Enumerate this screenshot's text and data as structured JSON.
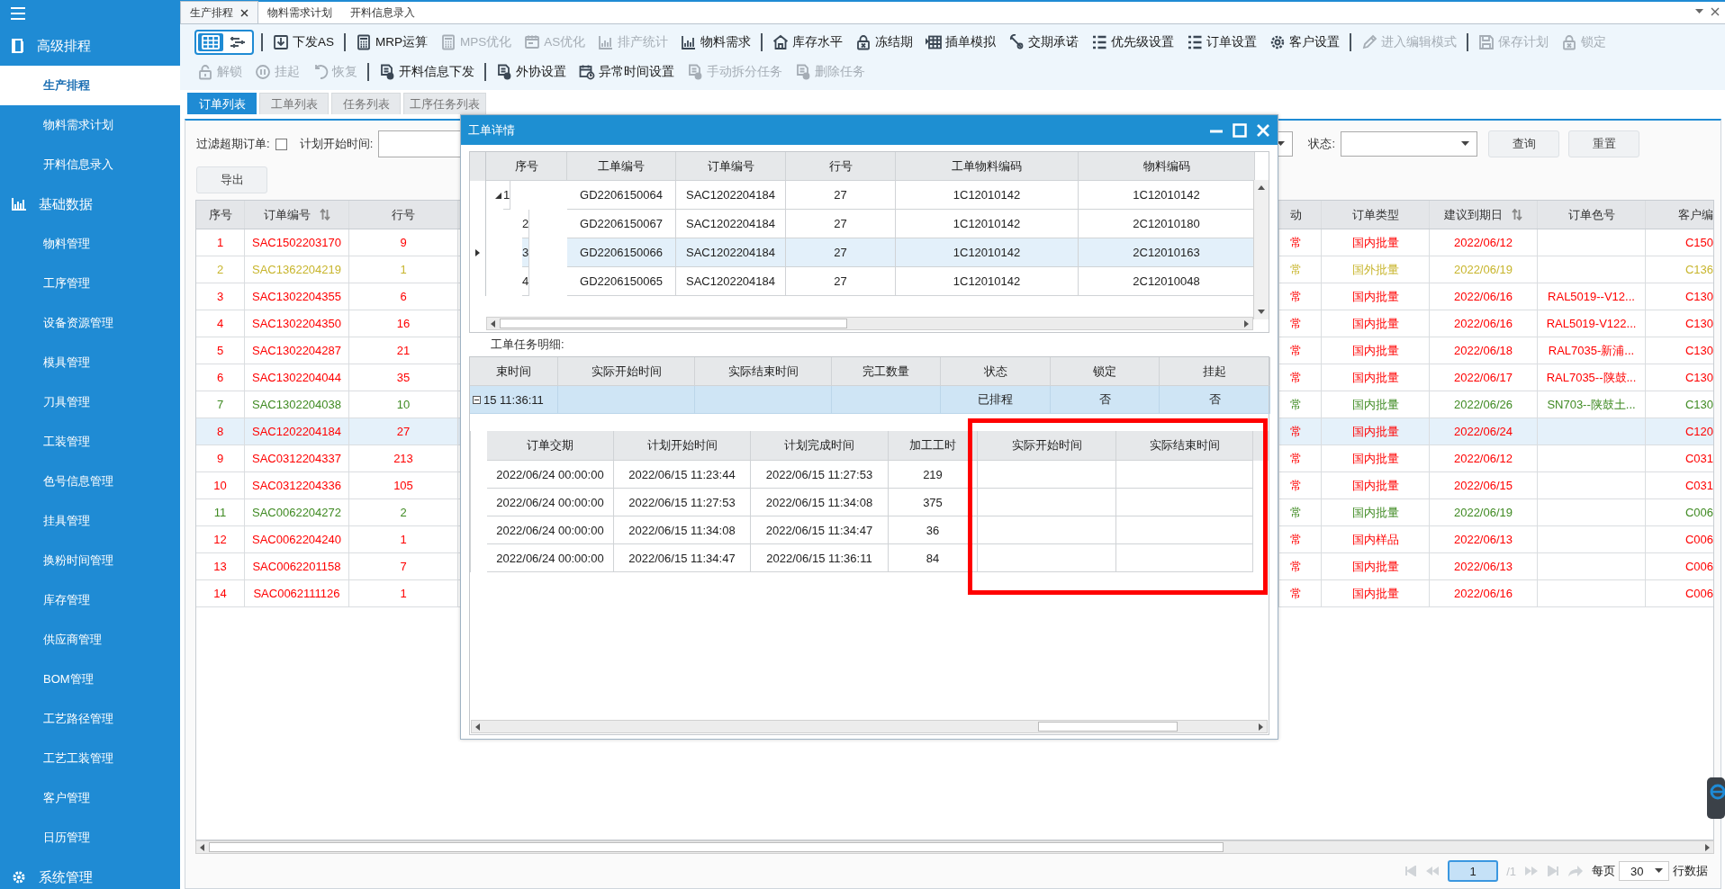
{
  "sidebar": {
    "groups": [
      {
        "label": "高级排程",
        "items": [
          {
            "label": "生产排程",
            "selected": true
          },
          {
            "label": "物料需求计划",
            "selected": false
          },
          {
            "label": "开料信息录入",
            "selected": false
          }
        ]
      },
      {
        "label": "基础数据",
        "items": [
          {
            "label": "物料管理",
            "selected": false
          },
          {
            "label": "工序管理",
            "selected": false
          },
          {
            "label": "设备资源管理",
            "selected": false
          },
          {
            "label": "模具管理",
            "selected": false
          },
          {
            "label": "刀具管理",
            "selected": false
          },
          {
            "label": "工装管理",
            "selected": false
          },
          {
            "label": "色号信息管理",
            "selected": false
          },
          {
            "label": "挂具管理",
            "selected": false
          },
          {
            "label": "换粉时间管理",
            "selected": false
          },
          {
            "label": "库存管理",
            "selected": false
          },
          {
            "label": "供应商管理",
            "selected": false
          },
          {
            "label": "BOM管理",
            "selected": false
          },
          {
            "label": "工艺路径管理",
            "selected": false
          },
          {
            "label": "工艺工装管理",
            "selected": false
          },
          {
            "label": "客户管理",
            "selected": false
          },
          {
            "label": "日历管理",
            "selected": false
          }
        ]
      },
      {
        "label": "系统管理"
      }
    ]
  },
  "doc_tabs": [
    {
      "label": "生产排程",
      "selected": true,
      "closable": true
    },
    {
      "label": "物料需求计划",
      "selected": false,
      "closable": false
    },
    {
      "label": "开料信息录入",
      "selected": false,
      "closable": false
    }
  ],
  "toolbar": {
    "rows": [
      [
        {
          "kind": "view-toggle",
          "options": [
            {
              "selected": true
            },
            {
              "selected": false
            }
          ]
        },
        {
          "kind": "separator"
        },
        {
          "kind": "button",
          "label": "下发AS",
          "disabled": false
        },
        {
          "kind": "separator"
        },
        {
          "kind": "button",
          "label": "MRP运算",
          "disabled": false
        },
        {
          "kind": "button",
          "label": "MPS优化",
          "disabled": true
        },
        {
          "kind": "button",
          "label": "AS优化",
          "disabled": true
        },
        {
          "kind": "button",
          "label": "排产统计",
          "disabled": true
        },
        {
          "kind": "button",
          "label": "物料需求",
          "disabled": false
        },
        {
          "kind": "separator"
        },
        {
          "kind": "button",
          "label": "库存水平",
          "disabled": false
        },
        {
          "kind": "button",
          "label": "冻结期",
          "disabled": false
        },
        {
          "kind": "button",
          "label": "插单模拟",
          "disabled": false
        },
        {
          "kind": "button",
          "label": "交期承诺",
          "disabled": false
        },
        {
          "kind": "button",
          "label": "优先级设置",
          "disabled": false
        },
        {
          "kind": "button",
          "label": "订单设置",
          "disabled": false
        },
        {
          "kind": "button",
          "label": "客户设置",
          "disabled": false
        },
        {
          "kind": "separator"
        },
        {
          "kind": "button",
          "label": "进入编辑模式",
          "disabled": true
        },
        {
          "kind": "separator"
        },
        {
          "kind": "button",
          "label": "保存计划",
          "disabled": true
        },
        {
          "kind": "button",
          "label": "锁定",
          "disabled": true
        }
      ],
      [
        {
          "kind": "button",
          "label": "解锁",
          "disabled": true
        },
        {
          "kind": "button",
          "label": "挂起",
          "disabled": true
        },
        {
          "kind": "button",
          "label": "恢复",
          "disabled": true
        },
        {
          "kind": "separator"
        },
        {
          "kind": "button",
          "label": "开料信息下发",
          "disabled": false
        },
        {
          "kind": "separator"
        },
        {
          "kind": "button",
          "label": "外协设置",
          "disabled": false
        },
        {
          "kind": "button",
          "label": "异常时间设置",
          "disabled": false
        },
        {
          "kind": "button",
          "label": "手动拆分任务",
          "disabled": true
        },
        {
          "kind": "button",
          "label": "删除任务",
          "disabled": true
        }
      ]
    ]
  },
  "subtabs": [
    {
      "label": "订单列表",
      "selected": true
    },
    {
      "label": "工单列表",
      "selected": false
    },
    {
      "label": "任务列表",
      "selected": false
    },
    {
      "label": "工序任务列表",
      "selected": false
    }
  ],
  "filters": {
    "overdue_label": "过滤超期订单:",
    "overdue_checked": false,
    "start_label": "计划开始时间:",
    "status_label": "状态:",
    "query_button": "查询",
    "reset_button": "重置",
    "export_button": "导出"
  },
  "orders": {
    "columns": [
      {
        "label": "序号",
        "sortable": false
      },
      {
        "label": "订单编号",
        "sortable": true
      },
      {
        "label": "行号",
        "sortable": false
      },
      {
        "label": "动",
        "sortable": false
      },
      {
        "label": "订单类型",
        "sortable": false
      },
      {
        "label": "建议到期日",
        "sortable": true
      },
      {
        "label": "订单色号",
        "sortable": false
      },
      {
        "label": "客户编",
        "sortable": false
      }
    ],
    "rows": [
      {
        "no": "1",
        "order_no": "SAC1502203170",
        "line": "9",
        "column_4": "常",
        "type": "国内批量",
        "due": "2022/06/12",
        "customer": "C150",
        "color": "#ff0000",
        "selected": false
      },
      {
        "no": "2",
        "order_no": "SAC1362204219",
        "line": "1",
        "column_4": "常",
        "type": "国外批量",
        "due": "2022/06/19",
        "customer": "C136",
        "color": "#c8b52c",
        "selected": false
      },
      {
        "no": "3",
        "order_no": "SAC1302204355",
        "line": "6",
        "column_4": "常",
        "type": "国内批量",
        "due": "2022/06/16",
        "color_code": "RAL5019--V12...",
        "customer": "C130",
        "color": "#ff0000",
        "selected": false
      },
      {
        "no": "4",
        "order_no": "SAC1302204350",
        "line": "16",
        "column_4": "常",
        "type": "国内批量",
        "due": "2022/06/16",
        "color_code": "RAL5019-V122...",
        "customer": "C130",
        "color": "#ff0000",
        "selected": false
      },
      {
        "no": "5",
        "order_no": "SAC1302204287",
        "line": "21",
        "column_4": "常",
        "type": "国内批量",
        "due": "2022/06/18",
        "color_code": "RAL7035-新浦...",
        "customer": "C130",
        "color": "#ff0000",
        "selected": false
      },
      {
        "no": "6",
        "order_no": "SAC1302204044",
        "line": "35",
        "column_4": "常",
        "type": "国内批量",
        "due": "2022/06/17",
        "color_code": "RAL7035--陕鼓...",
        "customer": "C130",
        "color": "#ff0000",
        "selected": false
      },
      {
        "no": "7",
        "order_no": "SAC1302204038",
        "line": "10",
        "column_4": "常",
        "type": "国内批量",
        "due": "2022/06/26",
        "color_code": "SN703--陕鼓土...",
        "customer": "C130",
        "color": "#3f8a22",
        "selected": false
      },
      {
        "no": "8",
        "order_no": "SAC1202204184",
        "line": "27",
        "column_4": "常",
        "type": "国内批量",
        "due": "2022/06/24",
        "customer": "C120",
        "color": "#ff0000",
        "selected": true
      },
      {
        "no": "9",
        "order_no": "SAC0312204337",
        "line": "213",
        "column_4": "常",
        "type": "国内批量",
        "due": "2022/06/12",
        "customer": "C031",
        "color": "#ff0000",
        "selected": false
      },
      {
        "no": "10",
        "order_no": "SAC0312204336",
        "line": "105",
        "column_4": "常",
        "type": "国内批量",
        "due": "2022/06/15",
        "customer": "C031",
        "color": "#ff0000",
        "selected": false
      },
      {
        "no": "11",
        "order_no": "SAC0062204272",
        "line": "2",
        "column_4": "常",
        "type": "国内批量",
        "due": "2022/06/19",
        "customer": "C006",
        "color": "#3f8a22",
        "selected": false
      },
      {
        "no": "12",
        "order_no": "SAC0062204240",
        "line": "1",
        "column_4": "常",
        "type": "国内样品",
        "due": "2022/06/13",
        "customer": "C006",
        "color": "#ff0000",
        "selected": false
      },
      {
        "no": "13",
        "order_no": "SAC0062201158",
        "line": "7",
        "column_4": "常",
        "type": "国内批量",
        "due": "2022/06/13",
        "customer": "C006",
        "color": "#ff0000",
        "selected": false
      },
      {
        "no": "14",
        "order_no": "SAC0062111126",
        "line": "1",
        "column_4": "常",
        "type": "国内批量",
        "due": "2022/06/16",
        "customer": "C006",
        "color": "#ff0000",
        "selected": false
      }
    ]
  },
  "pager": {
    "page": "1",
    "total": "/1",
    "per_page_label": "每页",
    "per_page": "30",
    "rows_label": "行数据"
  },
  "dialog": {
    "title": "工单详情",
    "work_orders": {
      "columns": [
        "序号",
        "工单编号",
        "订单编号",
        "行号",
        "工单物料编码",
        "物料编码"
      ],
      "rows": [
        {
          "no": "1",
          "work_order": "GD2206150064",
          "order_no": "SAC1202204184",
          "line": "27",
          "wo_material": "1C12010142",
          "material": "1C12010142",
          "expanded": true,
          "selected": false,
          "children": [
            {
              "no": "2",
              "work_order": "GD2206150067",
              "order_no": "SAC1202204184",
              "line": "27",
              "wo_material": "1C12010142",
              "material": "2C12010180",
              "selected": false
            },
            {
              "no": "3",
              "work_order": "GD2206150066",
              "order_no": "SAC1202204184",
              "line": "27",
              "wo_material": "1C12010142",
              "material": "2C12010163",
              "selected": true
            },
            {
              "no": "4",
              "work_order": "GD2206150065",
              "order_no": "SAC1202204184",
              "line": "27",
              "wo_material": "1C12010142",
              "material": "2C12010048",
              "selected": false
            }
          ]
        }
      ]
    },
    "tasks_label": "工单任务明细:",
    "tasks": {
      "columns": [
        "束时间",
        "实际开始时间",
        "实际结束时间",
        "完工数量",
        "状态",
        "锁定",
        "挂起"
      ],
      "rows": [
        {
          "column_1": "15 11:36:11",
          "status": "已排程",
          "locked": "否",
          "suspended": "否",
          "expanded": true,
          "selected": true,
          "details": {
            "columns": [
              "订单交期",
              "计划开始时间",
              "计划完成时间",
              "加工工时",
              "实际开始时间",
              "实际结束时间"
            ],
            "rows": [
              {
                "due": "2022/06/24 00:00:00",
                "plan_start": "2022/06/15 11:23:44",
                "plan_end": "2022/06/15 11:27:53",
                "hours": "219"
              },
              {
                "due": "2022/06/24 00:00:00",
                "plan_start": "2022/06/15 11:27:53",
                "plan_end": "2022/06/15 11:34:08",
                "hours": "375"
              },
              {
                "due": "2022/06/24 00:00:00",
                "plan_start": "2022/06/15 11:34:08",
                "plan_end": "2022/06/15 11:34:47",
                "hours": "36"
              },
              {
                "due": "2022/06/24 00:00:00",
                "plan_start": "2022/06/15 11:34:47",
                "plan_end": "2022/06/15 11:36:11",
                "hours": "84"
              }
            ]
          }
        }
      ]
    }
  }
}
